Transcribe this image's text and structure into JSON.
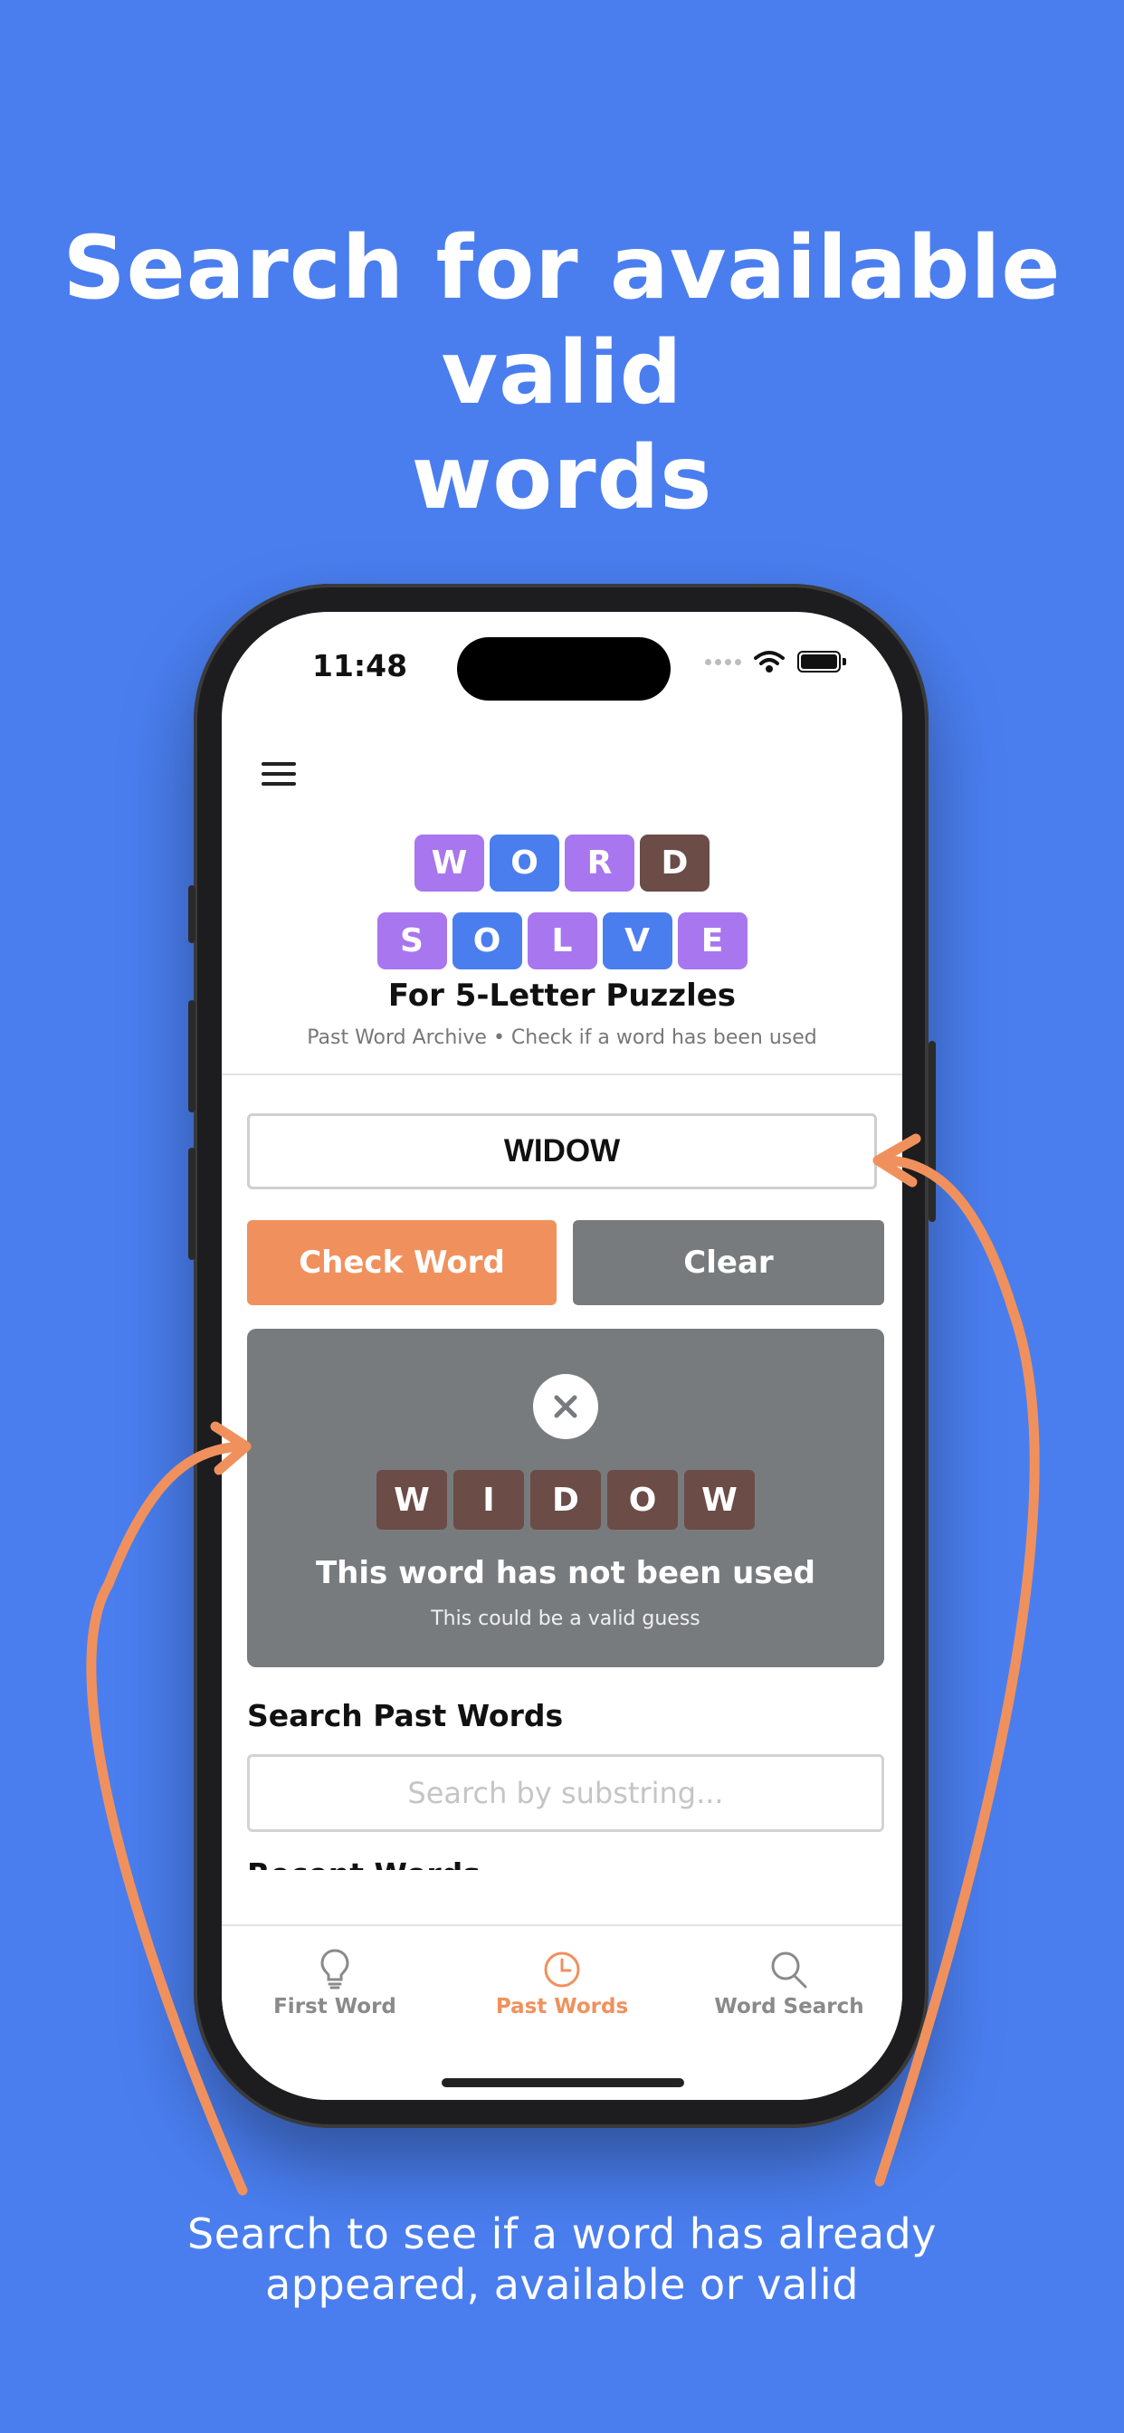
{
  "promo": {
    "headline_line1": "Search for available valid",
    "headline_line2": "words",
    "caption_line1": "Search to see if a word has already",
    "caption_line2": "appeared, available or valid"
  },
  "status_bar": {
    "time": "11:48"
  },
  "logo": {
    "row1": [
      "W",
      "O",
      "R",
      "D"
    ],
    "row2": [
      "S",
      "O",
      "L",
      "V",
      "E"
    ],
    "title": "For 5-Letter Puzzles",
    "tagline": "Past Word Archive • Check if a word has been used"
  },
  "checker": {
    "input_value": "WIDOW",
    "check_label": "Check Word",
    "clear_label": "Clear"
  },
  "result": {
    "letters": [
      "W",
      "I",
      "D",
      "O",
      "W"
    ],
    "message": "This word has not been used",
    "submessage": "This could be a valid guess"
  },
  "search": {
    "title": "Search Past Words",
    "placeholder": "Search by substring...",
    "next_section_partial": "Recent Words"
  },
  "tabs": [
    {
      "label": "First Word",
      "icon": "lightbulb-icon"
    },
    {
      "label": "Past Words",
      "icon": "clock-icon"
    },
    {
      "label": "Word Search",
      "icon": "magnifier-icon"
    }
  ],
  "colors": {
    "background": "#4A7EEF",
    "purple": "#A876EE",
    "blue": "#4A7EEF",
    "brown": "#6B4C47",
    "orange": "#F0915D",
    "gray": "#787B7E"
  }
}
